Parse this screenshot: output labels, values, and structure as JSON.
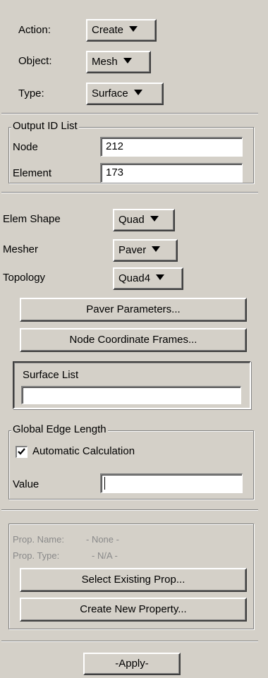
{
  "header": {
    "action": {
      "label": "Action:",
      "value": "Create"
    },
    "object": {
      "label": "Object:",
      "value": "Mesh"
    },
    "type": {
      "label": "Type:",
      "value": "Surface"
    }
  },
  "output_ids": {
    "legend": "Output ID List",
    "node": {
      "label": "Node",
      "value": "212"
    },
    "element": {
      "label": "Element",
      "value": "173"
    }
  },
  "mesh": {
    "elem_shape": {
      "label": "Elem Shape",
      "value": "Quad"
    },
    "mesher": {
      "label": "Mesher",
      "value": "Paver"
    },
    "topology": {
      "label": "Topology",
      "value": "Quad4"
    }
  },
  "buttons": {
    "paver_params": "Paver Parameters...",
    "node_coord_frames": "Node Coordinate Frames...",
    "select_existing_prop": "Select Existing Prop...",
    "create_new_property": "Create New Property...",
    "apply": "-Apply-"
  },
  "surface_list": {
    "label": "Surface List",
    "value": ""
  },
  "edge_length": {
    "legend": "Global Edge Length",
    "auto_calc": {
      "label": "Automatic Calculation",
      "checked": true
    },
    "value": {
      "label": "Value",
      "value": ""
    }
  },
  "property": {
    "name_label": "Prop. Name:",
    "name_value": "- None -",
    "type_label": "Prop. Type:",
    "type_value": "- N/A -"
  }
}
